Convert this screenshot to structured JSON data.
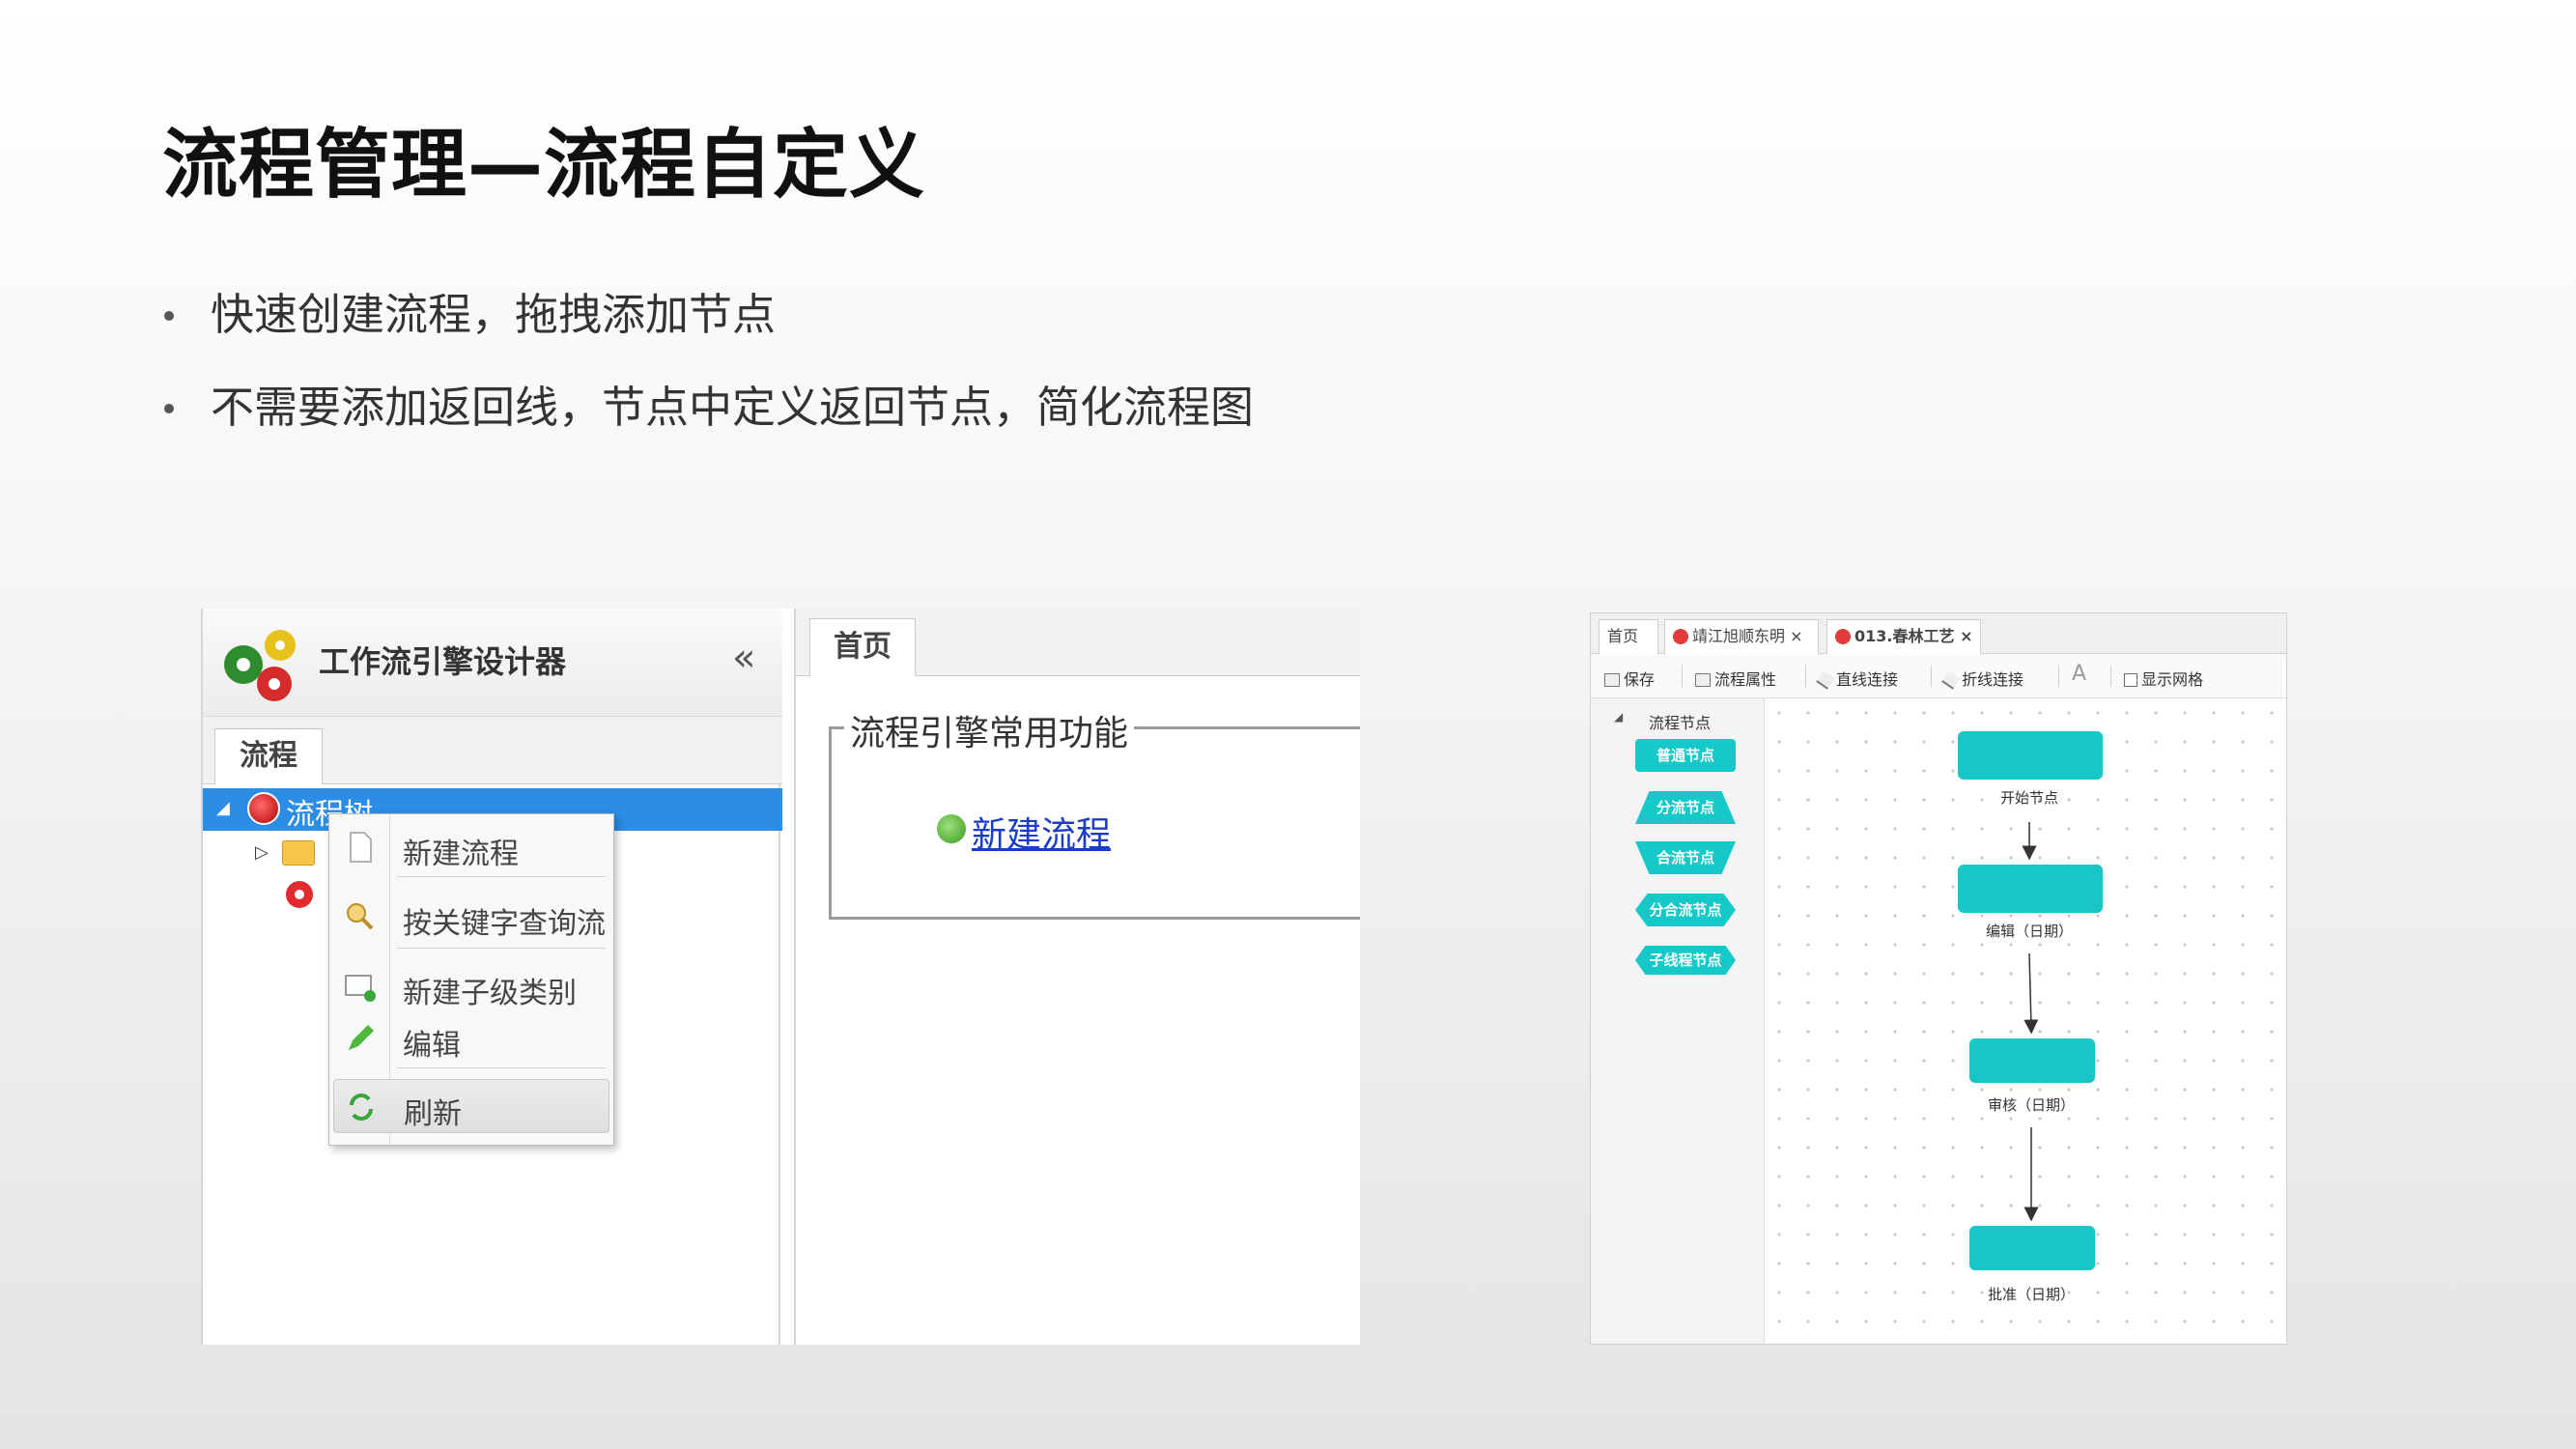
{
  "slide": {
    "title": "流程管理—流程自定义",
    "bullets": [
      "快速创建流程，拖拽添加节点",
      "不需要添加返回线，节点中定义返回节点，简化流程图"
    ]
  },
  "designer": {
    "title": "工作流引擎设计器",
    "collapse_label": "«",
    "tab_label": "流程",
    "tree": {
      "root_label": "流程树"
    },
    "context_menu": {
      "items": [
        {
          "label": "新建流程",
          "icon": "new-document-icon"
        },
        {
          "label": "按关键字查询流",
          "icon": "search-key-icon"
        },
        {
          "label": "新建子级类别",
          "icon": "new-subcategory-icon"
        },
        {
          "label": "编辑",
          "icon": "pencil-icon"
        },
        {
          "label": "刷新",
          "icon": "refresh-icon"
        }
      ]
    }
  },
  "home": {
    "tab_label": "首页",
    "section_title": "流程引擎常用功能",
    "link_label": "新建流程"
  },
  "editor": {
    "tabs": [
      "首页",
      "靖江旭顺东明",
      "013.春林工艺"
    ],
    "toolbar": {
      "save": "保存",
      "props": "流程属性",
      "straight": "直线连接",
      "polyline": "折线连接",
      "text": "A",
      "grid": "显示网格"
    },
    "palette": {
      "title": "流程节点",
      "nodes": [
        "普通节点",
        "分流节点",
        "合流节点",
        "分合流节点",
        "子线程节点"
      ]
    },
    "flow_nodes": [
      {
        "label": "开始节点"
      },
      {
        "label": "编辑（日期）"
      },
      {
        "label": "审核（日期）"
      },
      {
        "label": "批准（日期）"
      }
    ]
  },
  "colors": {
    "node_teal": "#18c6c6",
    "selected_blue": "#2b8de5",
    "link_blue": "#1a3cc8"
  }
}
